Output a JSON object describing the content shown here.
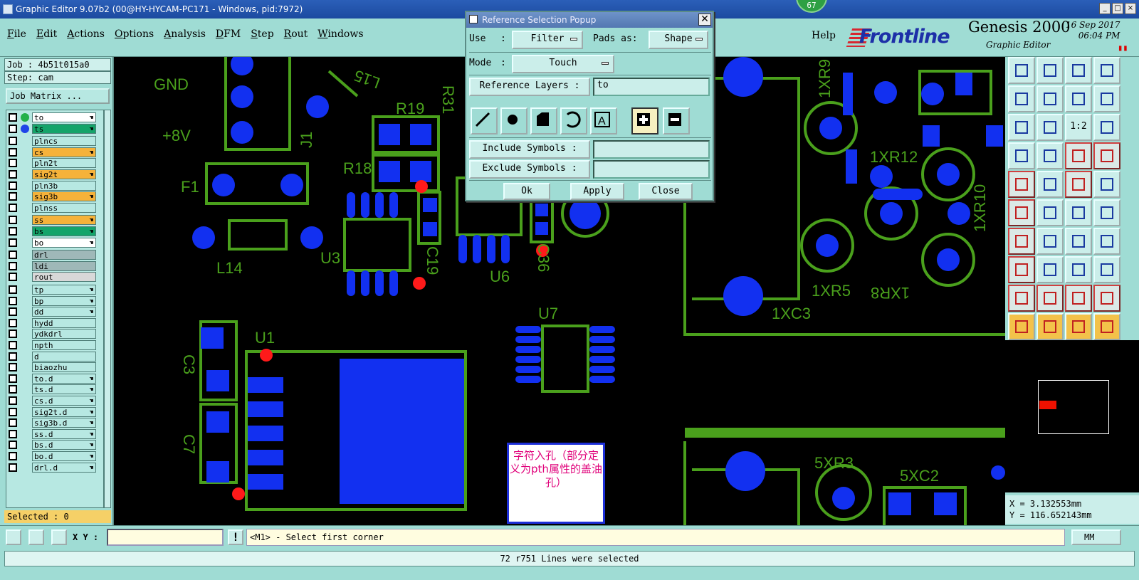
{
  "window": {
    "title": "Graphic Editor 9.07b2 (00@HY-HYCAM-PC171 - Windows, pid:7972)",
    "controls": [
      "_",
      "□",
      "×"
    ],
    "badge": "67"
  },
  "menubar": {
    "items": [
      "File",
      "Edit",
      "Actions",
      "Options",
      "Analysis",
      "DFM",
      "Step",
      "Rout",
      "Windows"
    ],
    "help": "Help",
    "logo": "Frontline",
    "product": "Genesis 2000",
    "product_sub": "Graphic Editor",
    "date": "16 Sep 2017",
    "time": "06:04 PM"
  },
  "left": {
    "job": "Job : 4b51t015a0",
    "step": "Step: cam",
    "job_matrix": "Job Matrix ...",
    "layers": [
      {
        "name": "to",
        "color": "#ffffff",
        "dot": "#22b04a",
        "hand": true
      },
      {
        "name": "ts",
        "color": "#15a46a",
        "dot": "#1f44e8",
        "hand": true
      },
      {
        "name": "plncs",
        "color": "#b7e8e2",
        "dot": "",
        "hand": false
      },
      {
        "name": "cs",
        "color": "#f5b23a",
        "dot": "",
        "hand": true
      },
      {
        "name": "pln2t",
        "color": "#b7e8e2",
        "dot": "",
        "hand": false
      },
      {
        "name": "sig2t",
        "color": "#f5b23a",
        "dot": "",
        "hand": true
      },
      {
        "name": "pln3b",
        "color": "#b7e8e2",
        "dot": "",
        "hand": false
      },
      {
        "name": "sig3b",
        "color": "#f5b23a",
        "dot": "",
        "hand": true
      },
      {
        "name": "plnss",
        "color": "#b7e8e2",
        "dot": "",
        "hand": false
      },
      {
        "name": "ss",
        "color": "#f5b23a",
        "dot": "",
        "hand": true
      },
      {
        "name": "bs",
        "color": "#15a46a",
        "dot": "",
        "hand": true
      },
      {
        "name": "bo",
        "color": "#ffffff",
        "dot": "",
        "hand": true
      },
      {
        "name": "drl",
        "color": "#9fb8b8",
        "dot": "",
        "hand": false
      },
      {
        "name": "ldi",
        "color": "#9fb8b8",
        "dot": "",
        "hand": false
      },
      {
        "name": "rout",
        "color": "#d8d8d8",
        "dot": "",
        "hand": false
      },
      {
        "name": "tp",
        "color": "#b7e8e2",
        "dot": "",
        "hand": true
      },
      {
        "name": "bp",
        "color": "#b7e8e2",
        "dot": "",
        "hand": true
      },
      {
        "name": "dd",
        "color": "#b7e8e2",
        "dot": "",
        "hand": true
      },
      {
        "name": "hydd",
        "color": "#b7e8e2",
        "dot": "",
        "hand": false
      },
      {
        "name": "ydkdrl",
        "color": "#b7e8e2",
        "dot": "",
        "hand": false
      },
      {
        "name": "npth",
        "color": "#b7e8e2",
        "dot": "",
        "hand": false
      },
      {
        "name": "d",
        "color": "#b7e8e2",
        "dot": "",
        "hand": false
      },
      {
        "name": "biaozhu",
        "color": "#b7e8e2",
        "dot": "",
        "hand": false
      },
      {
        "name": "to.d",
        "color": "#b7e8e2",
        "dot": "",
        "hand": true
      },
      {
        "name": "ts.d",
        "color": "#b7e8e2",
        "dot": "",
        "hand": true
      },
      {
        "name": "cs.d",
        "color": "#b7e8e2",
        "dot": "",
        "hand": true
      },
      {
        "name": "sig2t.d",
        "color": "#b7e8e2",
        "dot": "",
        "hand": true
      },
      {
        "name": "sig3b.d",
        "color": "#b7e8e2",
        "dot": "",
        "hand": true
      },
      {
        "name": "ss.d",
        "color": "#b7e8e2",
        "dot": "",
        "hand": true
      },
      {
        "name": "bs.d",
        "color": "#b7e8e2",
        "dot": "",
        "hand": true
      },
      {
        "name": "bo.d",
        "color": "#b7e8e2",
        "dot": "",
        "hand": true
      },
      {
        "name": "drl.d",
        "color": "#b7e8e2",
        "dot": "",
        "hand": true
      }
    ],
    "selected": "Selected : 0"
  },
  "canvas": {
    "labels": [
      "GND",
      "+8V",
      "F1",
      "L14",
      "U3",
      "R19",
      "R18",
      "R31",
      "J1",
      "L15",
      "C19",
      "U6",
      "C36",
      "U7",
      "U1",
      "C3",
      "C7",
      "1XR9",
      "1XR12",
      "1XR10",
      "1XR5",
      "1XC3",
      "1XR8",
      "5XR3",
      "5XC2"
    ],
    "note": "字符入孔（部分定义为pth属性的盖油孔）",
    "colors": {
      "trace": "#4aa01c",
      "pad": "#1230f0",
      "hole": "#ff1a1a"
    }
  },
  "popup": {
    "title": "Reference Selection Popup",
    "use_label": "Use",
    "use_value": "Filter",
    "pads_label": "Pads as:",
    "pads_value": "Shape",
    "mode_label": "Mode",
    "mode_value": "Touch",
    "ref_layers_label": "Reference Layers :",
    "ref_layers_value": "to",
    "include_label": "Include Symbols :",
    "include_value": "",
    "exclude_label": "Exclude Symbols :",
    "exclude_value": "",
    "ok": "Ok",
    "apply": "Apply",
    "close": "Close"
  },
  "right": {
    "x": "X = 3.132553mm",
    "y": "Y = 116.652143mm",
    "scale": "1:2"
  },
  "bottom": {
    "xy_label": "X Y :",
    "xy_value": "",
    "warn": "!",
    "prompt": "<M1> - Select first corner",
    "units": "MM",
    "status": "72 r751 Lines were selected"
  }
}
